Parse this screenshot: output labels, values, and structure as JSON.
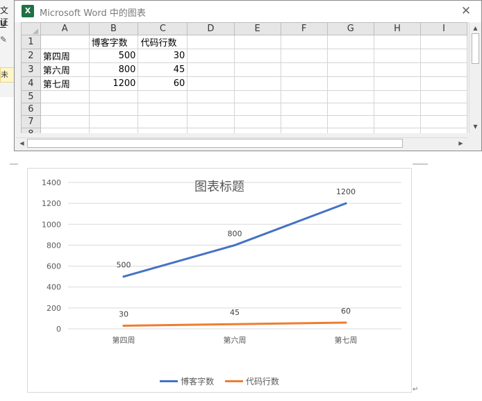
{
  "word": {
    "strip_text_top": "文证",
    "strip_text_u": "U",
    "strip_yellow_text": "未激"
  },
  "excel": {
    "logo_letter": "X",
    "title": "Microsoft Word 中的图表",
    "close_glyph": "✕",
    "columns": [
      "A",
      "B",
      "C",
      "D",
      "E",
      "F",
      "G",
      "H",
      "I"
    ],
    "rows": [
      {
        "num": "1",
        "cells": [
          "",
          "博客字数",
          "代码行数",
          "",
          "",
          "",
          "",
          "",
          ""
        ]
      },
      {
        "num": "2",
        "cells": [
          "第四周",
          "500",
          "30",
          "",
          "",
          "",
          "",
          "",
          ""
        ]
      },
      {
        "num": "3",
        "cells": [
          "第六周",
          "800",
          "45",
          "",
          "",
          "",
          "",
          "",
          ""
        ]
      },
      {
        "num": "4",
        "cells": [
          "第七周",
          "1200",
          "60",
          "",
          "",
          "",
          "",
          "",
          ""
        ]
      },
      {
        "num": "5",
        "cells": [
          "",
          "",
          "",
          "",
          "",
          "",
          "",
          "",
          ""
        ]
      },
      {
        "num": "6",
        "cells": [
          "",
          "",
          "",
          "",
          "",
          "",
          "",
          "",
          ""
        ]
      },
      {
        "num": "7",
        "cells": [
          "",
          "",
          "",
          "",
          "",
          "",
          "",
          "",
          ""
        ]
      },
      {
        "num": "8",
        "cells": [
          "",
          "",
          "",
          "",
          "",
          "",
          "",
          "",
          ""
        ]
      }
    ]
  },
  "chart_data": {
    "type": "line",
    "title": "图表标题",
    "categories": [
      "第四周",
      "第六周",
      "第七周"
    ],
    "series": [
      {
        "name": "博客字数",
        "values": [
          500,
          800,
          1200
        ],
        "color": "#4472c4"
      },
      {
        "name": "代码行数",
        "values": [
          30,
          45,
          60
        ],
        "color": "#ed7d31"
      }
    ],
    "ylim": [
      0,
      1400
    ],
    "yticks": [
      0,
      200,
      400,
      600,
      800,
      1000,
      1200,
      1400
    ],
    "grid": true,
    "legend": "bottom",
    "data_labels": true
  },
  "colors": {
    "excel_green": "#1e7145",
    "gridline": "#d9d9d9",
    "text": "#595959"
  }
}
